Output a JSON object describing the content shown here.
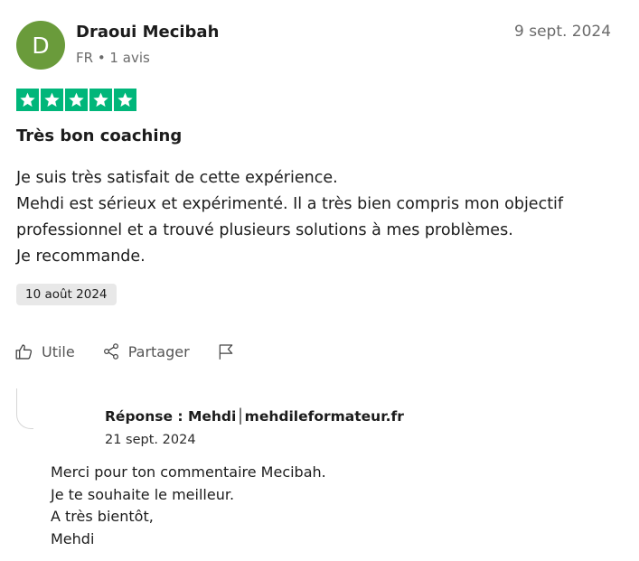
{
  "review": {
    "avatar_letter": "D",
    "avatar_color": "#6a9b3b",
    "reviewer_name": "Draoui Mecibah",
    "reviewer_meta": "FR • 1 avis",
    "review_date": "9 sept. 2024",
    "rating": 5,
    "star_color": "#00b67a",
    "title": "Très bon coaching",
    "body_lines": [
      "Je suis très satisfait de cette expérience.",
      "Mehdi est sérieux et expérimenté. Il a très bien compris mon objectif",
      "professionnel et a trouvé plusieurs solutions à mes problèmes.",
      "Je recommande."
    ],
    "experience_date": "10 août 2024"
  },
  "actions": {
    "useful_label": "Utile",
    "share_label": "Partager",
    "report_icon": "flag-icon"
  },
  "reply": {
    "header": "Réponse : Mehdi│mehdileformateur.fr",
    "date": "21 sept. 2024",
    "body_lines": [
      "Merci pour ton commentaire Mecibah.",
      "Je te souhaite le meilleur.",
      "A très bientôt,",
      "Mehdi"
    ]
  }
}
